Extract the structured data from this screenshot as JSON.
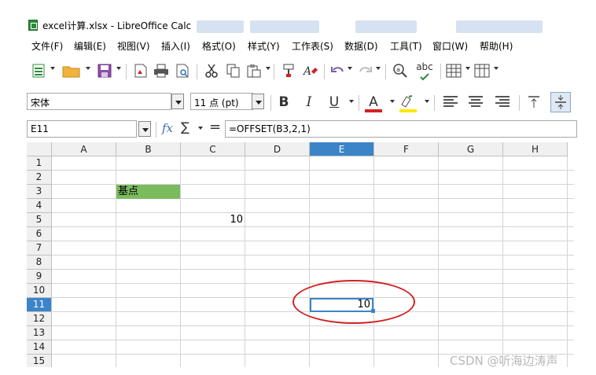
{
  "window": {
    "title": "excel计算.xlsx - LibreOffice Calc"
  },
  "menu": [
    "文件(F)",
    "编辑(E)",
    "视图(V)",
    "插入(I)",
    "格式(O)",
    "样式(Y)",
    "工作表(S)",
    "数据(D)",
    "工具(T)",
    "窗口(W)",
    "帮助(H)"
  ],
  "toolbar": {
    "spellcheck_label": "abc"
  },
  "format_toolbar": {
    "font_name": "宋体",
    "font_size": "11 点 (pt)",
    "bold_label": "B",
    "italic_label": "I",
    "underline_label": "U",
    "font_color_label": "A",
    "font_color": "#d42020",
    "highlight_color": "#ffe600"
  },
  "formula_bar": {
    "cell_reference": "E11",
    "fx_label": "fx",
    "sum_label": "∑",
    "equals_label": "=",
    "formula": "=OFFSET(B3,2,1)"
  },
  "sheet": {
    "columns": [
      "A",
      "B",
      "C",
      "D",
      "E",
      "F",
      "G",
      "H"
    ],
    "rows": [
      "1",
      "2",
      "3",
      "4",
      "5",
      "6",
      "7",
      "8",
      "9",
      "10",
      "11",
      "12",
      "13",
      "14",
      "15"
    ],
    "active_column": "E",
    "active_row": "11",
    "cells": {
      "B3": "基点",
      "C5": "10",
      "E11": "10"
    },
    "highlight_color": "#7abb5e",
    "selection_color": "#3c84c8",
    "annotation_color": "#d42020"
  },
  "watermark": "CSDN @听海边涛声"
}
